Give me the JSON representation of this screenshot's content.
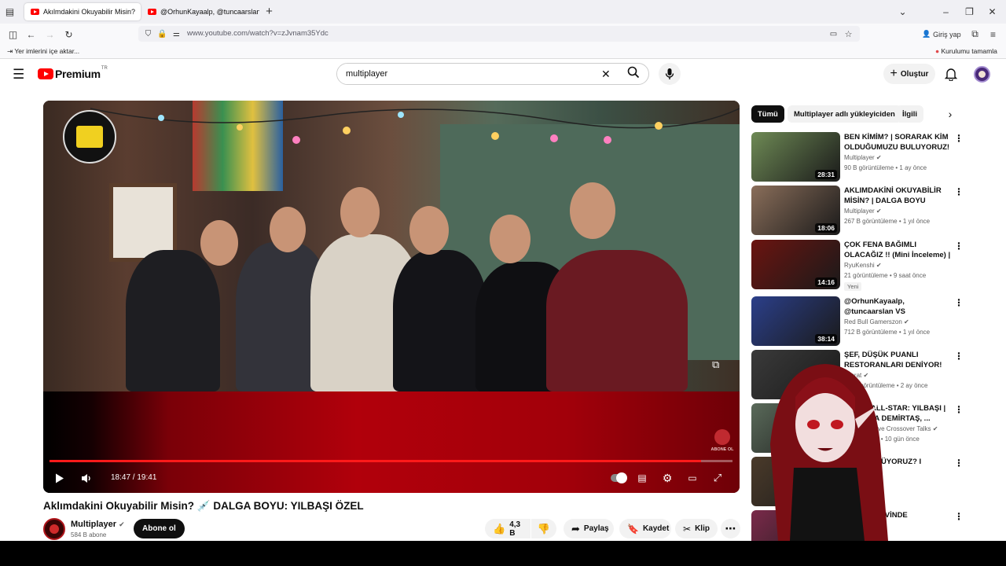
{
  "browser": {
    "tabs": [
      {
        "label": "Akılmdakini Okuyabilir Misin?",
        "active": true
      },
      {
        "label": "@OrhunKayaalp, @tuncaarslan",
        "active": false
      }
    ],
    "new_tab": "+",
    "url": "www.youtube.com/watch?v=zJvnam35Ydc",
    "sign_in": "Giriş yap",
    "bookmarks_import": "Yer imlerini içe aktar...",
    "setup_complete": "Kurulumu tamamla"
  },
  "youtube": {
    "logo_text": "Premium",
    "logo_region": "TR",
    "search_value": "multiplayer",
    "create_label": "Oluştur"
  },
  "video": {
    "current_time": "18:47",
    "separator": " / ",
    "duration": "19:41",
    "progress": 0.954,
    "overlay_text": "ABONE OL",
    "title": "Aklımdakini Okuyabilir Misin? 💉 DALGA BOYU: YILBAŞI ÖZEL",
    "channel": "Multiplayer",
    "subscribers": "584 B abone",
    "subscribe_label": "Abone ol",
    "likes": "4,3 B",
    "share_label": "Paylaş",
    "save_label": "Kaydet",
    "clip_label": "Klip"
  },
  "sidebar": {
    "chips": [
      "Tümü",
      "Multiplayer adlı yükleyiciden",
      "İlgili"
    ],
    "recs": [
      {
        "title": "BEN KİMİM? | SORARAK KİM OLDUĞUMUZU BULUYORUZ!",
        "channel": "Multiplayer",
        "views": "90 B görüntüleme",
        "age": "1 ay önce",
        "duration": "28:31",
        "color": "#6e8a55"
      },
      {
        "title": "AKLIMDAKİNİ OKUYABİLİR MİSİN? | DALGA BOYU",
        "channel": "Multiplayer",
        "views": "267 B görüntüleme",
        "age": "1 yıl önce",
        "duration": "18:06",
        "color": "#8a6e5a"
      },
      {
        "title": "ÇOK FENA BAĞIMLI OLACAĞIZ !! (Mini İnceleme) | LootBane ...",
        "channel": "RyuKenshi",
        "views": "21 görüntüleme",
        "age": "9 saat önce",
        "duration": "14:16",
        "color": "#6b1410",
        "badge": "Yeni"
      },
      {
        "title": "@OrhunKayaalp, @tuncaarslan VS @KayaogluDost, @emincit...",
        "channel": "Red Bull Gamerszon",
        "views": "712 B görüntüleme",
        "age": "1 yıl önce",
        "duration": "38:14",
        "color": "#2b3f8a"
      },
      {
        "title": "ŞEF, DÜŞÜK PUANLI RESTORANLARI DENİYOR!",
        "channel": "Literat",
        "views": "1 Mn görüntüleme",
        "age": "2 ay önce",
        "duration": "",
        "color": "#3a3a3a"
      },
      {
        "title": "SHOT | ALL-STAR: YILBAŞI | MUSTAFA DEMİRTAŞ, ...",
        "channel": "over Sports ve Crossover Talks",
        "views": "görüntüleme",
        "age": "10 gün önce",
        "duration": "",
        "color": "#5a6a5a"
      },
      {
        "title": "Mİ DÜŞÜNÜYORUZ? I",
        "channel": "",
        "views": "",
        "age": "1 yıl önce",
        "duration": "",
        "color": "#4a3a2a"
      },
      {
        "title": "N YALNIZ EVİNDE",
        "channel": "",
        "views": "",
        "age": "",
        "duration": "",
        "color": "#7a2a4a"
      }
    ]
  }
}
